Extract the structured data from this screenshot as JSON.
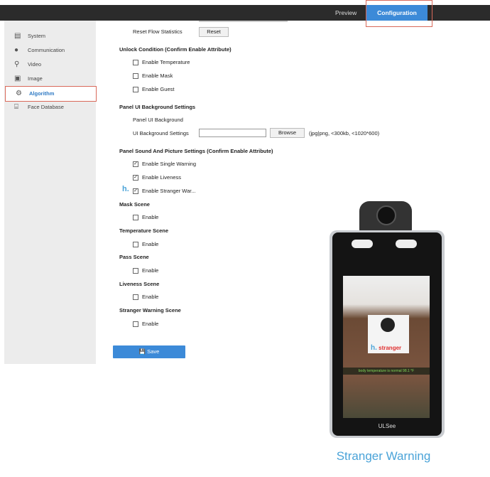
{
  "topbar": {
    "preview": "Preview",
    "configuration": "Configuration"
  },
  "sidebar": {
    "items": [
      {
        "label": "System",
        "icon": "system-icon"
      },
      {
        "label": "Communication",
        "icon": "globe-icon"
      },
      {
        "label": "Video",
        "icon": "video-icon"
      },
      {
        "label": "Image",
        "icon": "image-icon"
      },
      {
        "label": "Algorithm",
        "icon": "algorithm-icon"
      },
      {
        "label": "Face Database",
        "icon": "face-database-icon"
      }
    ]
  },
  "main": {
    "reset_label": "Reset Flow Statistics",
    "reset_button": "Reset",
    "unlock_heading": "Unlock Condition (Confirm Enable Attribute)",
    "unlock": [
      "Enable Temperature",
      "Enable Mask",
      "Enable Guest"
    ],
    "panel_ui_heading": "Panel UI Background Settings",
    "panel_ui_sub": "Panel UI Background",
    "ui_bg_label": "UI Background Settings",
    "ui_bg_value": "",
    "browse": "Browse",
    "ui_bg_hint": "(jpg|png, <300kb, <1020*600)",
    "sound_heading": "Panel Sound And Picture Settings (Confirm Enable Attribute)",
    "sound": [
      "Enable Single Warning",
      "Enable Liveness",
      "Enable Stranger War..."
    ],
    "scenes": [
      {
        "title": "Mask Scene",
        "label": "Enable"
      },
      {
        "title": "Temperature Scene",
        "label": "Enable"
      },
      {
        "title": "Pass Scene",
        "label": "Enable"
      },
      {
        "title": "Liveness Scene",
        "label": "Enable"
      },
      {
        "title": "Stranger Warning Scene",
        "label": "Enable"
      }
    ],
    "save": "Save"
  },
  "device": {
    "brand": "ULSee",
    "badge": "stranger",
    "temperature": "body temperature is normal 98.1 °F",
    "watermark": "h."
  },
  "caption": "Stranger Warning"
}
